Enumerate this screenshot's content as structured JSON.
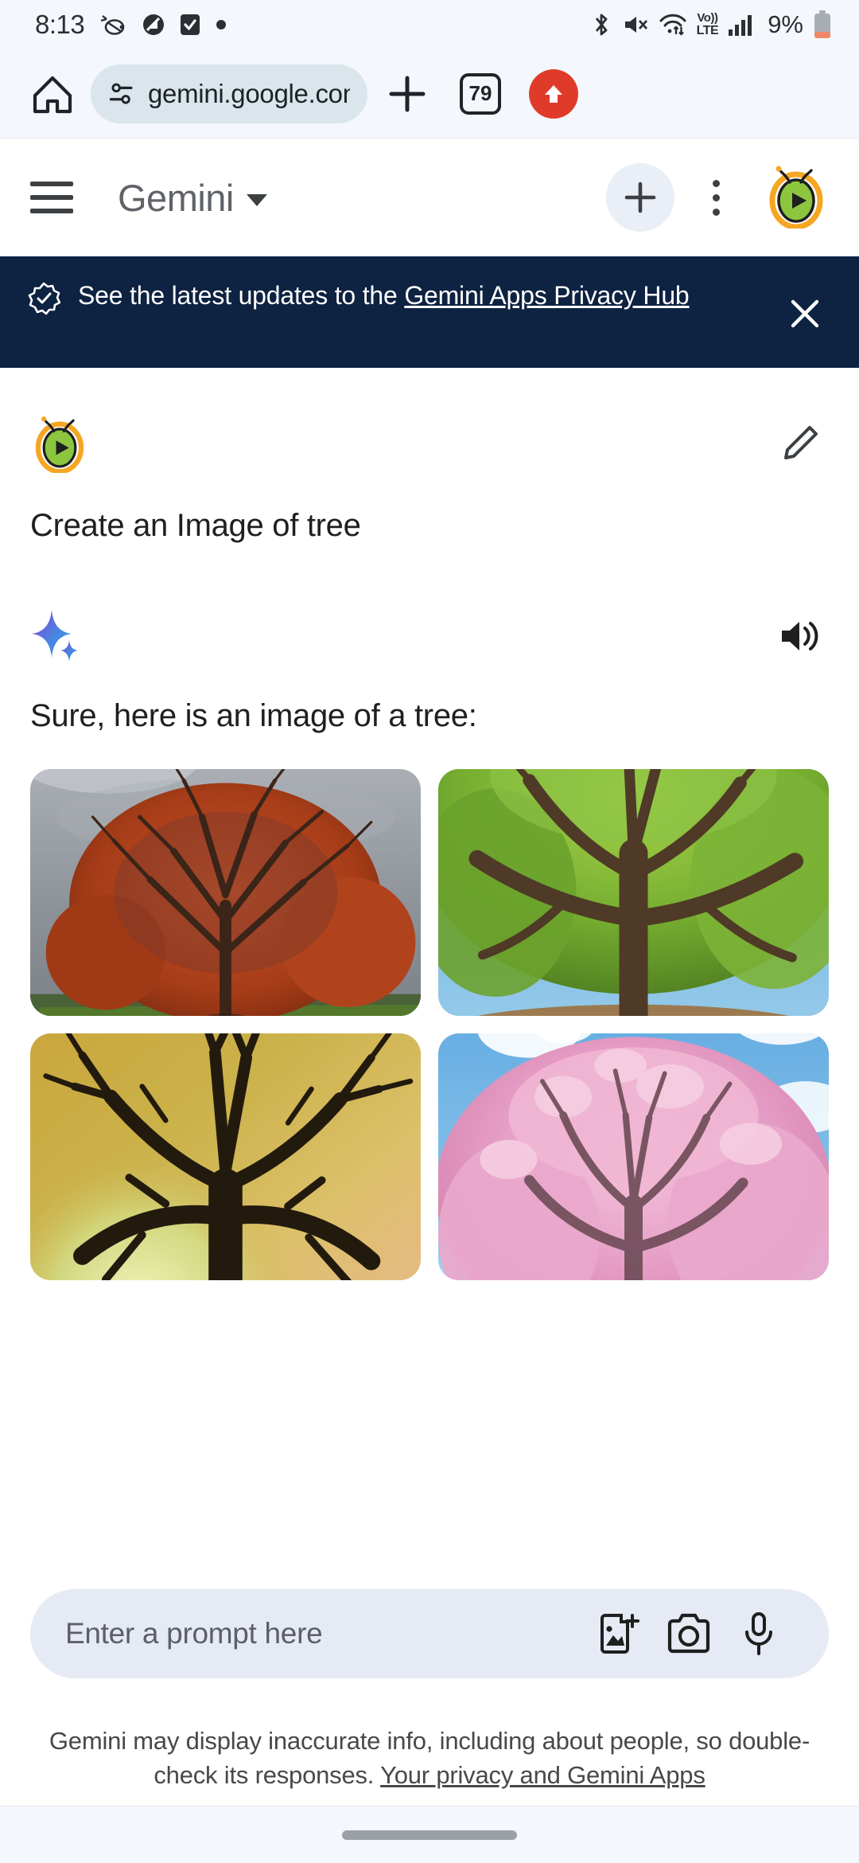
{
  "status_bar": {
    "time": "8:13",
    "battery_percent": "9%",
    "network_label_top": "Vo))",
    "network_label_bottom": "LTE",
    "left_icons": [
      "bee-app-icon",
      "do-not-disturb-icon",
      "checkbox-checked-icon",
      "dot-icon"
    ],
    "right_icons": [
      "bluetooth-icon",
      "mute-icon",
      "wifi-icon",
      "volte-icon",
      "signal-bars-icon",
      "battery-icon"
    ]
  },
  "browser": {
    "home_icon": "home-icon",
    "site_info_icon": "site-settings-icon",
    "url": "gemini.google.com/a",
    "new_tab_icon": "plus-icon",
    "tab_count": "79",
    "update_icon": "update-arrow-icon"
  },
  "app_header": {
    "menu_icon": "hamburger-menu-icon",
    "title": "Gemini",
    "caret_icon": "chevron-down-icon",
    "new_chat_icon": "plus-icon",
    "overflow_icon": "kebab-menu-icon",
    "avatar_icon": "account-avatar"
  },
  "notice": {
    "icon": "verified-badge-icon",
    "text_before": "See the latest updates to the ",
    "link_text": "Gemini Apps Privacy Hub",
    "close_icon": "close-icon",
    "background": "#0e2242"
  },
  "conversation": {
    "user_turn": {
      "avatar_icon": "account-avatar",
      "edit_icon": "pencil-edit-icon",
      "text": "Create an Image of tree"
    },
    "model_turn": {
      "sparkle_icon": "gemini-sparkle-icon",
      "speaker_icon": "speaker-volume-icon",
      "text": "Sure, here is an image of a tree:",
      "images": [
        {
          "alt": "autumn red maple tree under stormy sky",
          "palette": [
            "#8e9299",
            "#b34a22",
            "#4e8c2a"
          ]
        },
        {
          "alt": "large green oak tree with spreading branches",
          "palette": [
            "#6aa3d8",
            "#74a83c",
            "#5b4630"
          ]
        },
        {
          "alt": "bare silhouette tree at golden sunset",
          "palette": [
            "#c9a23c",
            "#9fbf4e",
            "#2a2014"
          ]
        },
        {
          "alt": "pink cherry blossom tree with blue sky",
          "palette": [
            "#6bb3e8",
            "#e8a7c9",
            "#ffffff"
          ]
        }
      ]
    }
  },
  "prompt_bar": {
    "placeholder": "Enter a prompt here",
    "value": "",
    "add_image_icon": "add-image-icon",
    "camera_icon": "camera-icon",
    "mic_icon": "microphone-icon"
  },
  "footer": {
    "text_before": "Gemini may display inaccurate info, including about people, so double-check its responses. ",
    "link_text": "Your privacy and Gemini Apps"
  },
  "gesture_bar": {
    "handle": "home-gesture-handle"
  },
  "colors": {
    "chrome_bg": "#f4f7fb",
    "omnibox_bg": "#dbe5ec",
    "notice_bg": "#0e2242",
    "prompt_bg": "#e6eaf4",
    "accent_red": "#e03b2a"
  }
}
